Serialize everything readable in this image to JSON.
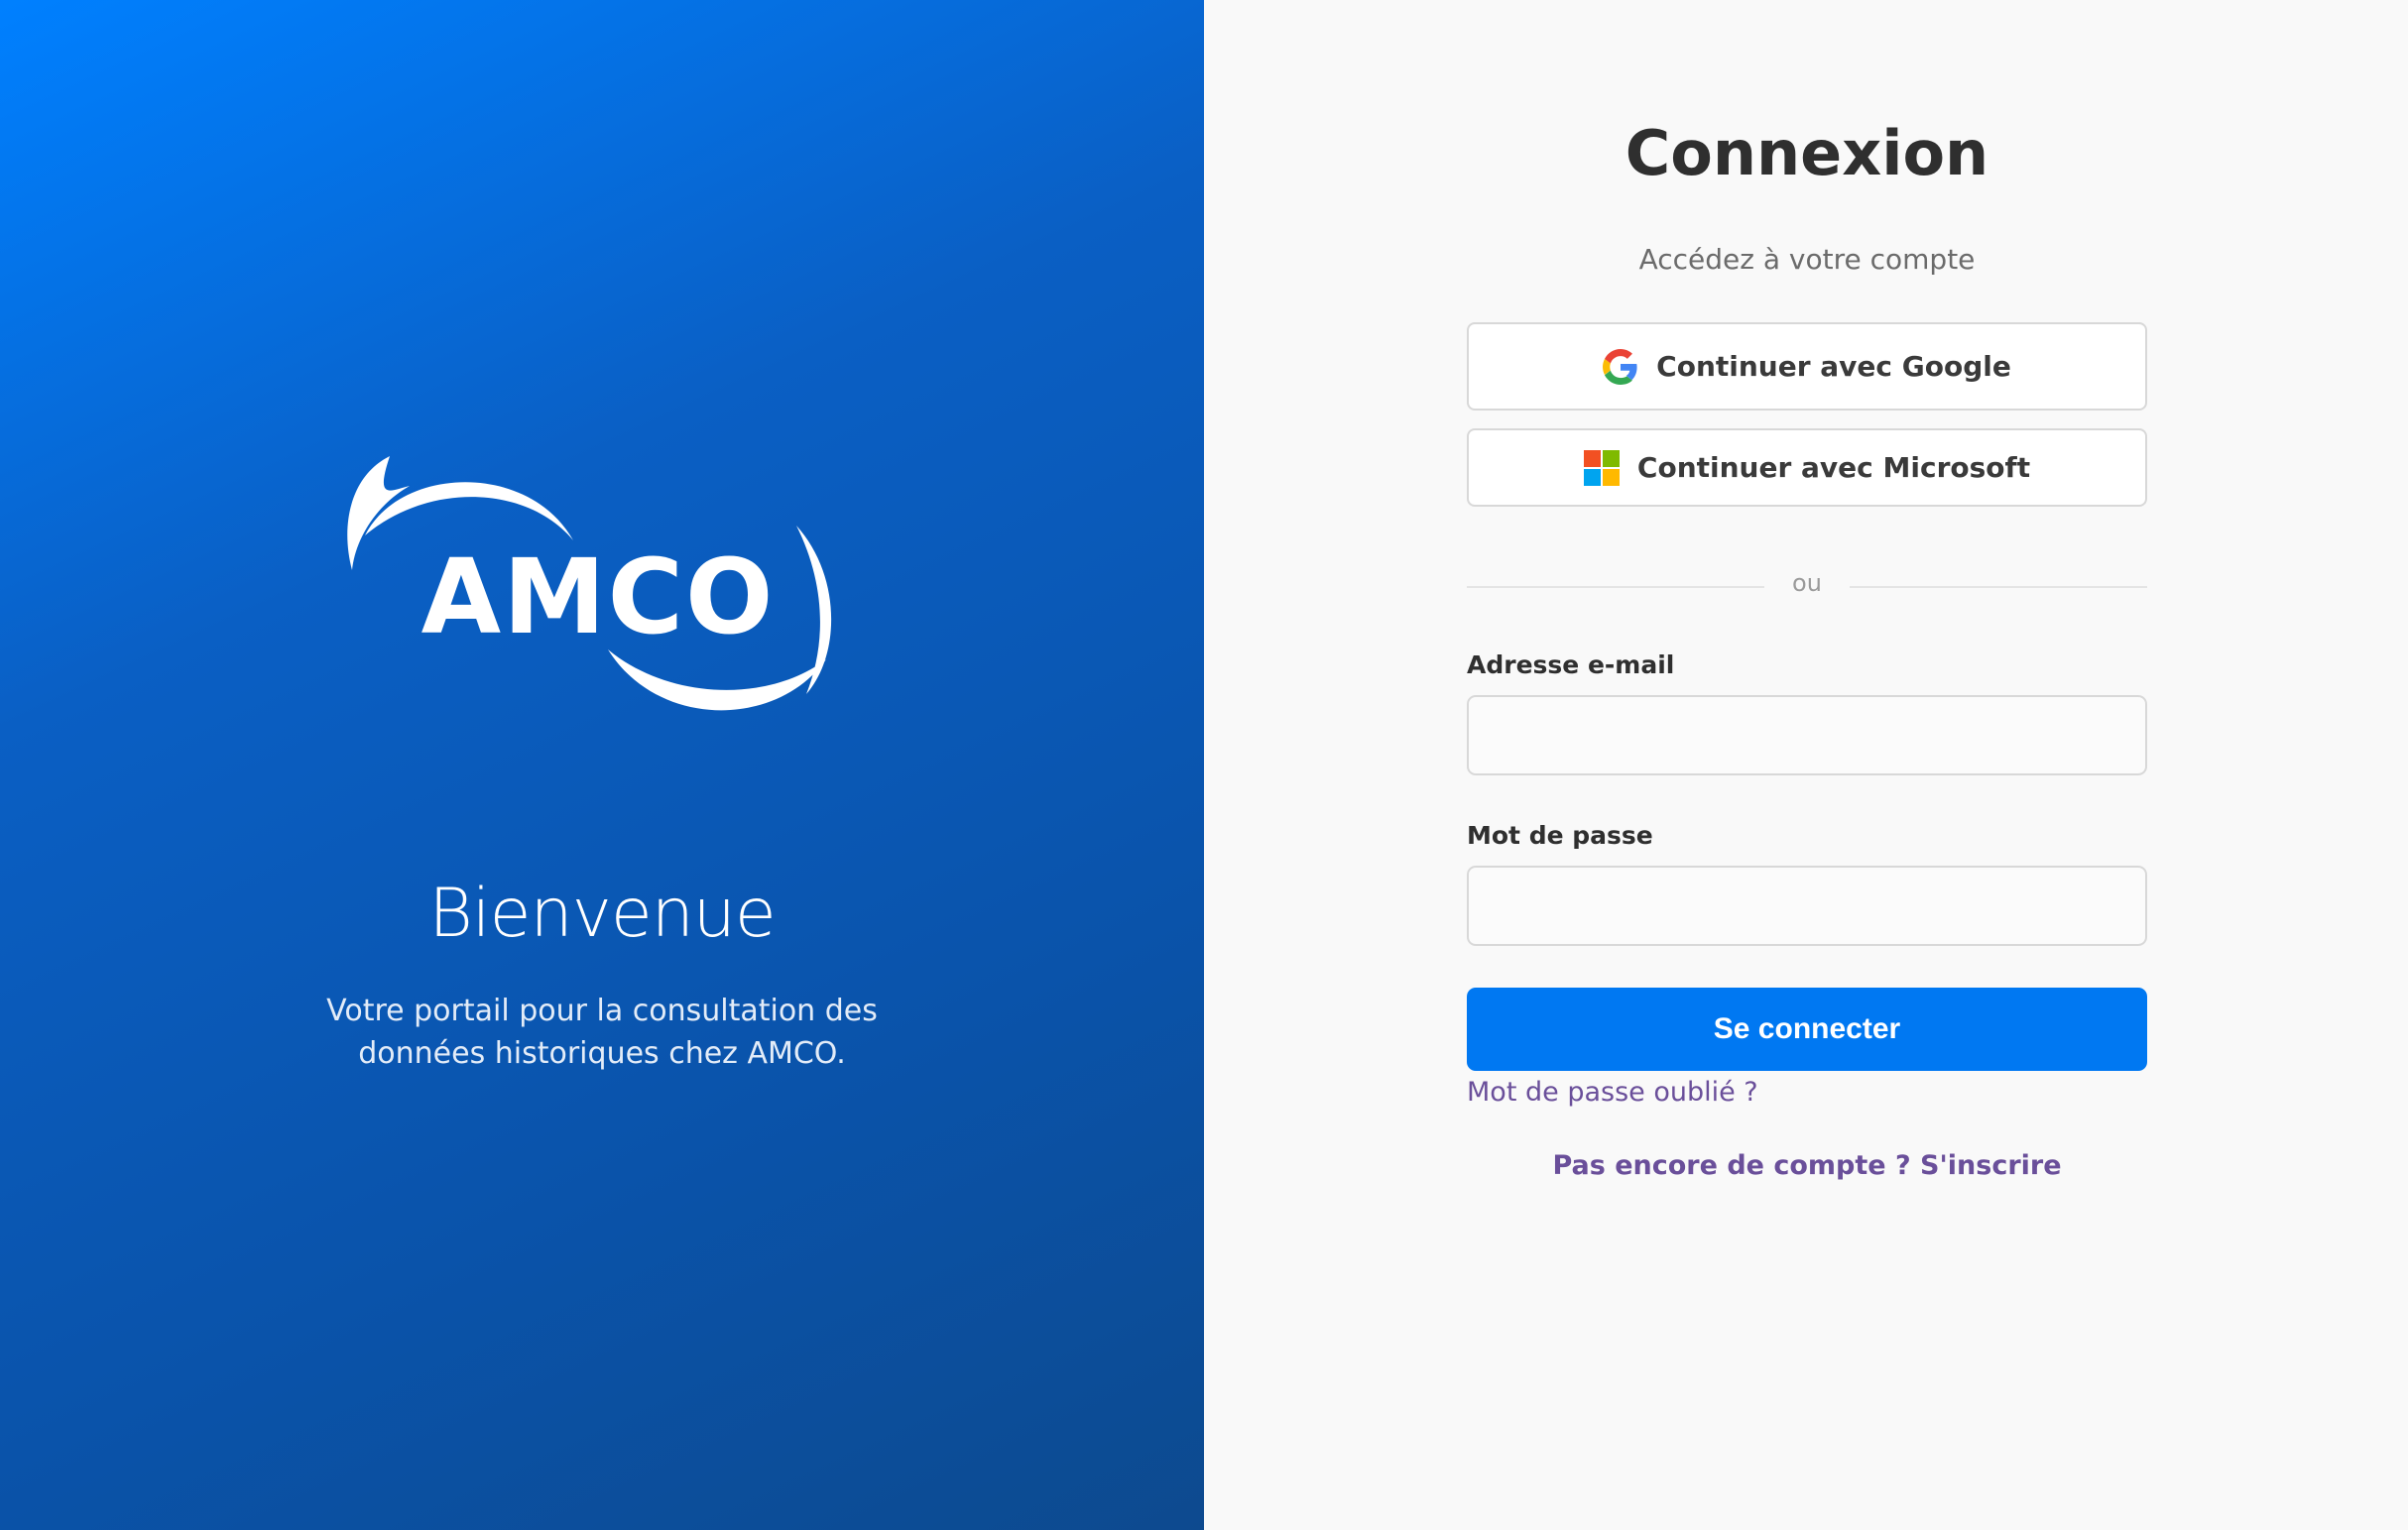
{
  "brand": {
    "logo_text": "AMCO",
    "welcome": "Bienvenue",
    "tagline": "Votre portail pour la consultation des données historiques chez AMCO.",
    "panel_gradient": [
      "#0080ff",
      "#0d4a8f"
    ]
  },
  "login": {
    "title": "Connexion",
    "subtitle": "Accédez à votre compte",
    "google_button": "Continuer avec Google",
    "microsoft_button": "Continuer avec Microsoft",
    "divider": "ou",
    "email_label": "Adresse e-mail",
    "email_value": "",
    "password_label": "Mot de passe",
    "password_value": "",
    "submit_button": "Se connecter",
    "forgot_link": "Mot de passe oublié ?",
    "signup_link": "Pas encore de compte ? S'inscrire"
  },
  "colors": {
    "primary": "#0078f2",
    "link": "#6a4f9a",
    "background": "#f9f9f9"
  },
  "icons": {
    "google": "google-g-icon",
    "microsoft": "microsoft-four-squares-icon"
  }
}
